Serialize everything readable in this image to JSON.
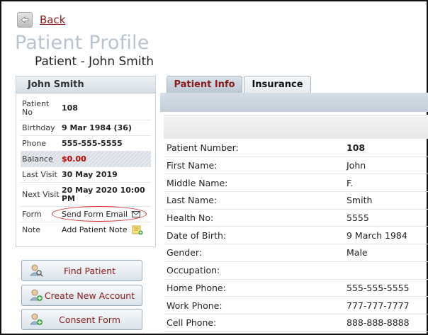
{
  "nav": {
    "back_label": "Back"
  },
  "page": {
    "title": "Patient Profile",
    "subtitle": "Patient - John Smith"
  },
  "card": {
    "header": "John Smith",
    "rows": [
      {
        "label": "Patient No",
        "value": "108"
      },
      {
        "label": "Birthday",
        "value": "9 Mar 1984 (36)"
      },
      {
        "label": "Phone",
        "value": "555-555-5555"
      },
      {
        "label": "Balance",
        "value": "$0.00"
      },
      {
        "label": "Last Visit",
        "value": "30 May 2019"
      },
      {
        "label": "Next Visit",
        "value": "20 May 2020 10:00 PM"
      },
      {
        "label": "Form",
        "value": "Send Form Email"
      },
      {
        "label": "Note",
        "value": "Add Patient Note"
      }
    ]
  },
  "side_buttons": [
    {
      "label": "Find Patient"
    },
    {
      "label": "Create New Account"
    },
    {
      "label": "Consent Form"
    }
  ],
  "tabs": [
    {
      "label": "Patient Info"
    },
    {
      "label": "Insurance"
    }
  ],
  "patient_info": [
    {
      "label": "Patient Number:",
      "value": "108"
    },
    {
      "label": "First Name:",
      "value": "John"
    },
    {
      "label": "Middle Name:",
      "value": "F."
    },
    {
      "label": "Last Name:",
      "value": "Smith"
    },
    {
      "label": "Health No:",
      "value": "5555"
    },
    {
      "label": "Date of Birth:",
      "value": "9 March 1984"
    },
    {
      "label": "Gender:",
      "value": "Male"
    },
    {
      "label": "Occupation:",
      "value": ""
    },
    {
      "label": "Home Phone:",
      "value": "555-555-5555"
    },
    {
      "label": "Work Phone:",
      "value": "777-777-7777"
    },
    {
      "label": "Cell Phone:",
      "value": "888-888-8888"
    }
  ],
  "colors": {
    "link": "#8b1a1a",
    "balance": "#c00000",
    "highlight_oval": "#d9282a"
  },
  "icons": [
    "back-arrow-icon",
    "mail-icon",
    "note-add-icon",
    "find-patient-icon",
    "create-account-icon",
    "consent-form-icon"
  ]
}
